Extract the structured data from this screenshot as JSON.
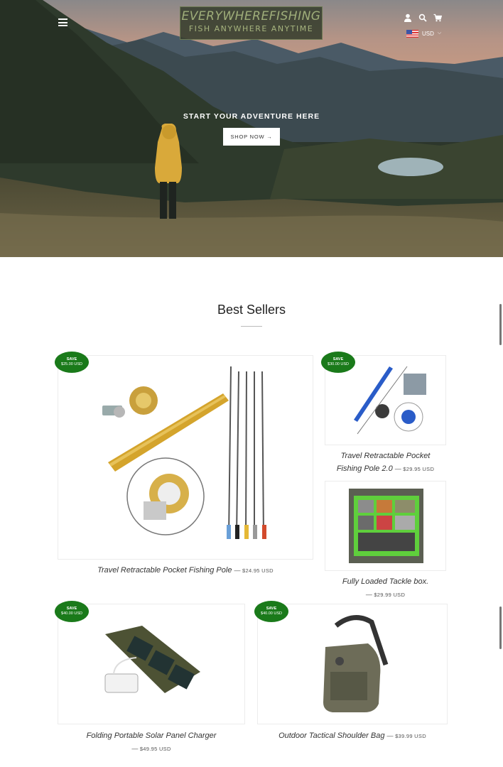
{
  "header": {
    "logo_line1": "EVERYWHEREFISHING",
    "logo_line2": "FISH ANYWHERE ANYTIME",
    "currency": "USD"
  },
  "hero": {
    "tagline": "START YOUR ADVENTURE HERE",
    "button_label": "SHOP NOW →"
  },
  "section": {
    "title": "Best Sellers"
  },
  "products": [
    {
      "title": "Travel Retractable Pocket Fishing Pole",
      "price": "$24.95 USD",
      "badge_label": "SAVE",
      "badge_amount": "$25.00 USD"
    },
    {
      "title_line1": "Travel Retractable Pocket",
      "title_line2": "Fishing Pole 2.0",
      "price": "$29.95 USD",
      "badge_label": "SAVE",
      "badge_amount": "$30.00 USD"
    },
    {
      "title": "Fully Loaded Tackle box.",
      "price": "$29.99 USD"
    },
    {
      "title": "Folding Portable Solar Panel Charger",
      "price": "$49.95 USD",
      "badge_label": "SAVE",
      "badge_amount": "$40.00 USD"
    },
    {
      "title": "Outdoor Tactical Shoulder Bag",
      "price": "$39.99 USD",
      "badge_label": "SAVE",
      "badge_amount": "$40.00 USD"
    }
  ],
  "colors": {
    "badge_green": "#1a7a1a",
    "logo_bg": "#373e2d"
  }
}
